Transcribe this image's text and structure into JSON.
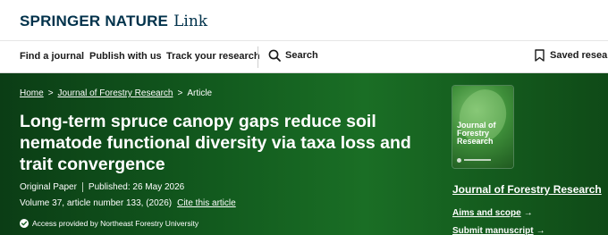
{
  "header": {
    "logo_primary": "SPRINGER NATURE",
    "logo_secondary": "Link"
  },
  "nav": {
    "find_journal": "Find a journal",
    "publish_with_us": "Publish with us",
    "track_research": "Track your research",
    "search_label": "Search",
    "search_icon": "search-icon",
    "saved_label": "Saved research",
    "saved_icon": "bookmark-icon"
  },
  "breadcrumb": {
    "home": "Home",
    "journal": "Journal of Forestry Research",
    "current": "Article",
    "separator": ">"
  },
  "article": {
    "title": "Long-term spruce canopy gaps reduce soil nematode functional diversity via taxa loss and trait convergence",
    "type": "Original Paper",
    "published": "Published: 26 May 2026",
    "volume_info": "Volume 37, article number 133, (2026)",
    "cite_label": "Cite this article",
    "access_text": "Access provided by Northeast Forestry University",
    "access_icon": "check-circle-icon"
  },
  "sidebar": {
    "cover_title": "Journal of Forestry Research",
    "journal_link": "Journal of Forestry Research",
    "aims_scope": "Aims and scope",
    "submit_manuscript": "Submit manuscript",
    "arrow": "→"
  },
  "colors": {
    "brand_navy": "#01324b",
    "hero_green": "#125a1e",
    "text_white": "#ffffff"
  }
}
